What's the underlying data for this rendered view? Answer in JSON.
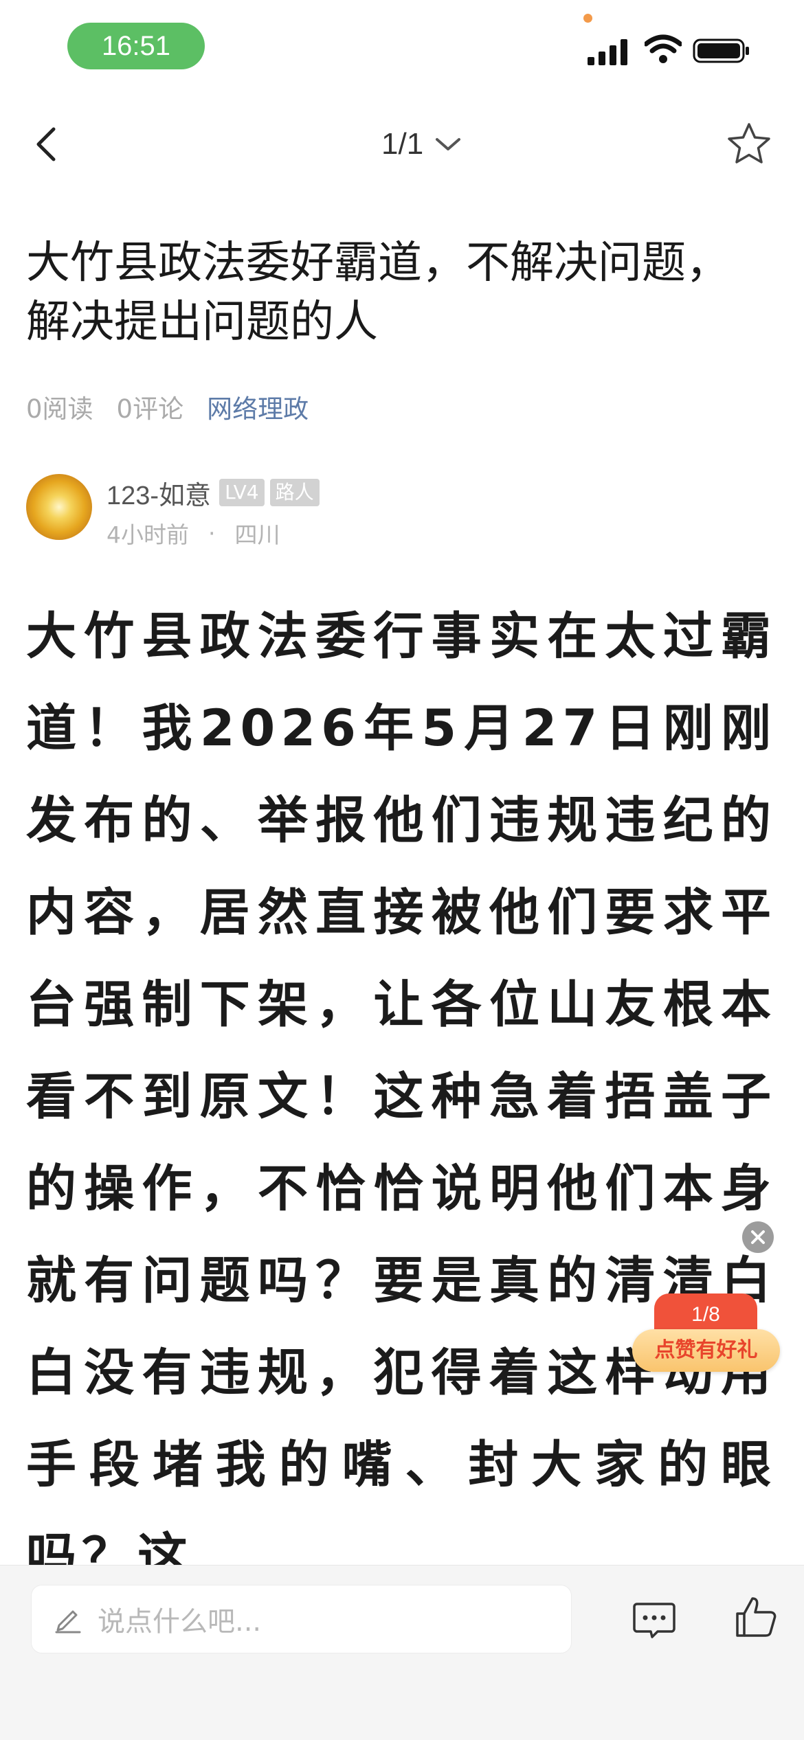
{
  "status_bar": {
    "time": "16:51"
  },
  "nav": {
    "pager": "1/1"
  },
  "post": {
    "title": "大竹县政法委好霸道，不解决问题，解决提出问题的人",
    "reads": "0阅读",
    "comments": "0评论",
    "tag": "网络理政"
  },
  "author": {
    "name": "123-如意",
    "level": "LV4",
    "role": "路人",
    "time": "4小时前",
    "separator": "·",
    "location": "四川"
  },
  "body_text": "大竹县政法委行事实在太过霸道！我2026年5月27日刚刚发布的、举报他们违规违纪的内容，居然直接被他们要求平台强制下架，让各位山友根本看不到原文！这种急着捂盖子的操作，不恰恰说明他们本身就有问题吗？要是真的清清白白没有违规，犯得着这样动用手段堵我的嘴、封大家的眼吗？这",
  "gift_widget": {
    "progress": "1/8",
    "label": "点赞有好礼"
  },
  "bottom_bar": {
    "comment_placeholder": "说点什么吧..."
  },
  "colors": {
    "time_pill": "#5cbf64",
    "tag": "#5d7ba8",
    "gift_red": "#f0523a",
    "gift_gold": "#f9c46d"
  },
  "icons": [
    "back-arrow-icon",
    "chevron-down-icon",
    "star-icon",
    "signal-icon",
    "wifi-icon",
    "battery-icon",
    "close-icon",
    "pen-icon",
    "comment-icon",
    "thumbs-up-icon"
  ]
}
